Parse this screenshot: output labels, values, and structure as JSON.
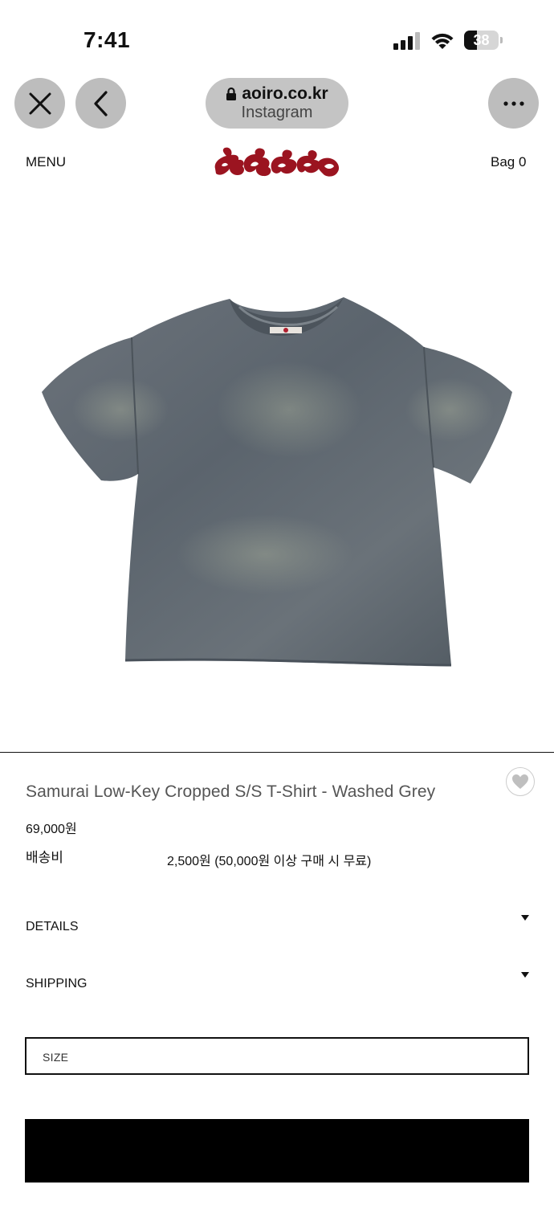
{
  "status_bar": {
    "time": "7:41",
    "battery": "38",
    "battery_level": 0.38,
    "icons": [
      "cellular-signal-icon",
      "wifi-icon",
      "battery-icon"
    ]
  },
  "browser": {
    "url": "aoiro.co.kr",
    "source": "Instagram",
    "icons": [
      "close-icon",
      "back-chevron-icon",
      "lock-icon",
      "more-icon"
    ]
  },
  "site_header": {
    "menu_label": "MENU",
    "bag_label": "Bag 0",
    "logo_text": "aoiro"
  },
  "product": {
    "title": "Samurai Low-Key Cropped S/S T-Shirt - Washed Grey",
    "price": "69,000원",
    "shipping_label": "배송비",
    "shipping_value": "2,500원 (50,000원 이상 구매 시 무료)",
    "image_icon": "tshirt-product-image"
  },
  "accordions": {
    "details": "DETAILS",
    "shipping": "SHIPPING"
  },
  "size_select": {
    "placeholder": "SIZE"
  },
  "colors": {
    "logo_red": "#9b1420",
    "shirt_grey": "#5d6670",
    "chrome_grey": "#bdbdbd"
  }
}
